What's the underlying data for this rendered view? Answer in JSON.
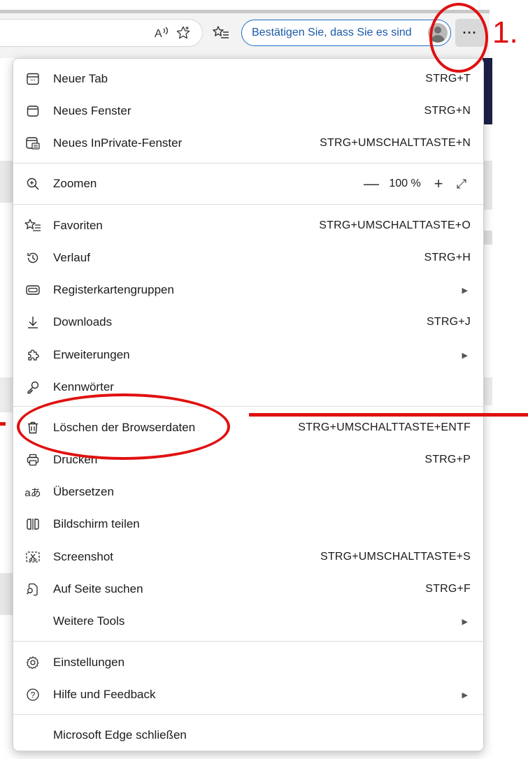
{
  "toolbar": {
    "read_aloud_icon": "read-aloud-icon",
    "favorite_icon": "star-icon",
    "favorites_list_icon": "favorites-list-icon",
    "sync_label": "Bestätigen Sie, dass Sie es sind",
    "more_label": "···"
  },
  "annotations": {
    "step_one": "1."
  },
  "menu": {
    "new_tab": {
      "label": "Neuer Tab",
      "shortcut": "STRG+T"
    },
    "new_window": {
      "label": "Neues Fenster",
      "shortcut": "STRG+N"
    },
    "new_private": {
      "label": "Neues InPrivate-Fenster",
      "shortcut": "STRG+UMSCHALTTASTE+N"
    },
    "zoom": {
      "label": "Zoomen",
      "value": "100 %",
      "minus": "—",
      "plus": "+",
      "expand": "⤢"
    },
    "favorites": {
      "label": "Favoriten",
      "shortcut": "STRG+UMSCHALTTASTE+O"
    },
    "history": {
      "label": "Verlauf",
      "shortcut": "STRG+H"
    },
    "tab_groups": {
      "label": "Registerkartengruppen"
    },
    "downloads": {
      "label": "Downloads",
      "shortcut": "STRG+J"
    },
    "extensions": {
      "label": "Erweiterungen"
    },
    "passwords": {
      "label": "Kennwörter"
    },
    "clear_data": {
      "label": "Löschen der Browserdaten",
      "shortcut": "STRG+UMSCHALTTASTE+ENTF"
    },
    "print": {
      "label": "Drucken",
      "shortcut": "STRG+P"
    },
    "translate": {
      "label": "Übersetzen"
    },
    "split_screen": {
      "label": "Bildschirm teilen"
    },
    "screenshot": {
      "label": "Screenshot",
      "shortcut": "STRG+UMSCHALTTASTE+S"
    },
    "find": {
      "label": "Auf Seite suchen",
      "shortcut": "STRG+F"
    },
    "more_tools": {
      "label": "Weitere Tools"
    },
    "settings": {
      "label": "Einstellungen"
    },
    "help": {
      "label": "Hilfe und Feedback"
    },
    "close_edge": {
      "label": "Microsoft Edge schließen"
    }
  }
}
